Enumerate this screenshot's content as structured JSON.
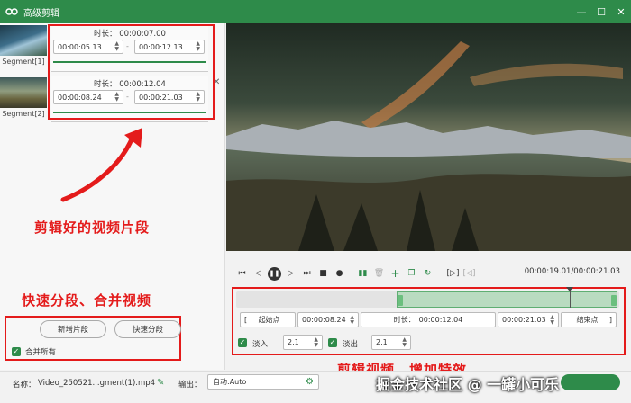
{
  "window": {
    "title": "高级剪辑",
    "minimize": "—",
    "maximize": "☐",
    "close": "✕"
  },
  "segments": [
    {
      "label": "Segment[1]",
      "duration": "时长： 00:00:07.00",
      "start": "00:00:05.13",
      "end": "00:00:12.13"
    },
    {
      "label": "Segment[2]",
      "duration": "时长： 00:00:12.04",
      "start": "00:00:08.24",
      "end": "00:00:21.03"
    }
  ],
  "annotations": {
    "segments_note": "剪辑好的视频片段",
    "split_note": "快速分段、合并视频",
    "effects_note": "剪辑视频，增加特效"
  },
  "buttons": {
    "add_segment": "新增片段",
    "quick_split": "快速分段",
    "merge_all": "合并所有"
  },
  "player": {
    "time": "00:00:19.01/00:00:21.03"
  },
  "trim": {
    "start_label": "起始点",
    "start_value": "00:00:08.24",
    "duration_label": "时长：",
    "duration_value": "00:00:12.04",
    "end_value": "00:00:21.03",
    "end_label": "结束点"
  },
  "effects": {
    "fade_in_label": "淡入",
    "fade_in_value": "2.1",
    "fade_out_label": "淡出",
    "fade_out_value": "2.1"
  },
  "footer": {
    "name_label": "名称：",
    "name_value": "Video_250521...gment(1).mp4",
    "output_label": "输出：",
    "output_value": "自动:Auto"
  },
  "watermark": "掘金技术社区 @ 一罐小可乐",
  "colors": {
    "accent": "#2e8b4a",
    "annotation": "#e41b1b"
  }
}
